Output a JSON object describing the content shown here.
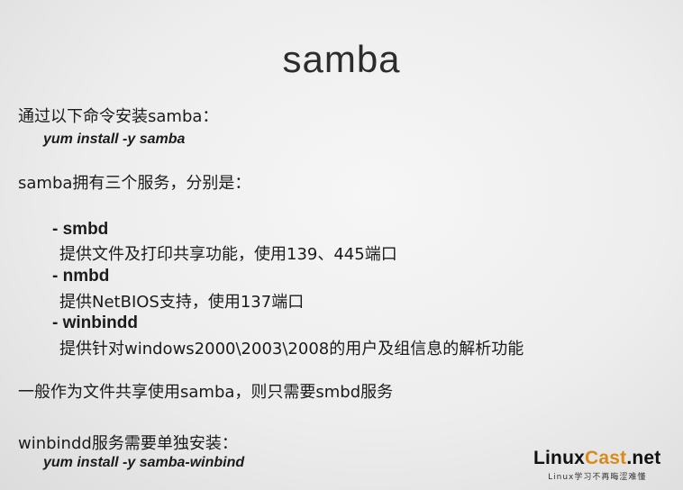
{
  "slide": {
    "title": "samba",
    "install_intro": "通过以下命令安装samba：",
    "install_cmd": "yum install -y samba",
    "services_intro": "samba拥有三个服务，分别是：",
    "services": [
      {
        "name": "- smbd",
        "desc": "提供文件及打印共享功能，使用139、445端口"
      },
      {
        "name": "- nmbd",
        "desc": "提供NetBIOS支持，使用137端口"
      },
      {
        "name": "- winbindd",
        "desc": "提供针对windows2000\\2003\\2008的用户及组信息的解析功能"
      }
    ],
    "note": "一般作为文件共享使用samba，则只需要smbd服务",
    "winbind_intro": "winbindd服务需要单独安装：",
    "winbind_cmd": "yum install -y samba-winbind"
  },
  "logo": {
    "linux": "Linux",
    "cast": "Cast",
    "net": ".net",
    "tagline": "Linux学习不再晦涩难懂"
  }
}
